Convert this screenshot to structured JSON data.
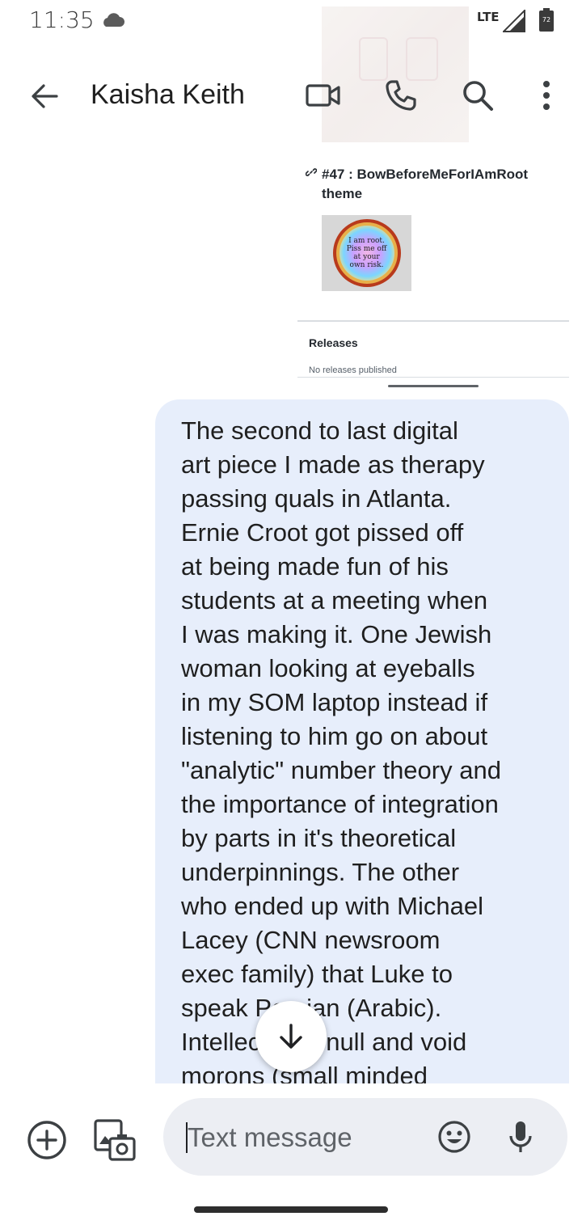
{
  "status_bar": {
    "time": "11:35",
    "network": "LTE",
    "battery_level": "72",
    "icons": [
      "cloud-icon",
      "signal-icon",
      "battery-icon"
    ]
  },
  "header": {
    "contact_name": "Kaisha Keith",
    "icons": [
      "back-arrow-icon",
      "video-call-icon",
      "phone-icon",
      "search-icon",
      "more-vert-icon"
    ]
  },
  "link_preview": {
    "title_line1": "#47 : BowBeforeMeForIAmRoot",
    "title_line2": "theme",
    "badge_text": "I am root. Piss me off at your own risk.",
    "releases_heading": "Releases",
    "releases_empty": "No releases published"
  },
  "message": {
    "text": "The second to last digital\nart piece I made as therapy\npassing quals in Atlanta.\nErnie Croot got pissed off\nat being made fun of his\nstudents at a meeting when\nI was making it. One Jewish\nwoman looking at eyeballs\nin my SOM laptop instead if\nlistening to him go on about\n\"analytic\" number theory and\nthe importance of integration\nby parts in it's theoretical\nunderpinnings. The other\nwho ended up with Michael\nLacey (CNN newsroom\nexec family) that Luke to\nspeak Persian (Arabic).\nIntellectually null and void\nmorons (small minded"
  },
  "compose": {
    "placeholder": "Text message",
    "icons": [
      "add-icon",
      "gallery-icon",
      "emoji-icon",
      "mic-icon"
    ]
  },
  "colors": {
    "bubble": "#e7eefb",
    "compose_field": "#eceef3",
    "text": "#1f1f1f"
  }
}
